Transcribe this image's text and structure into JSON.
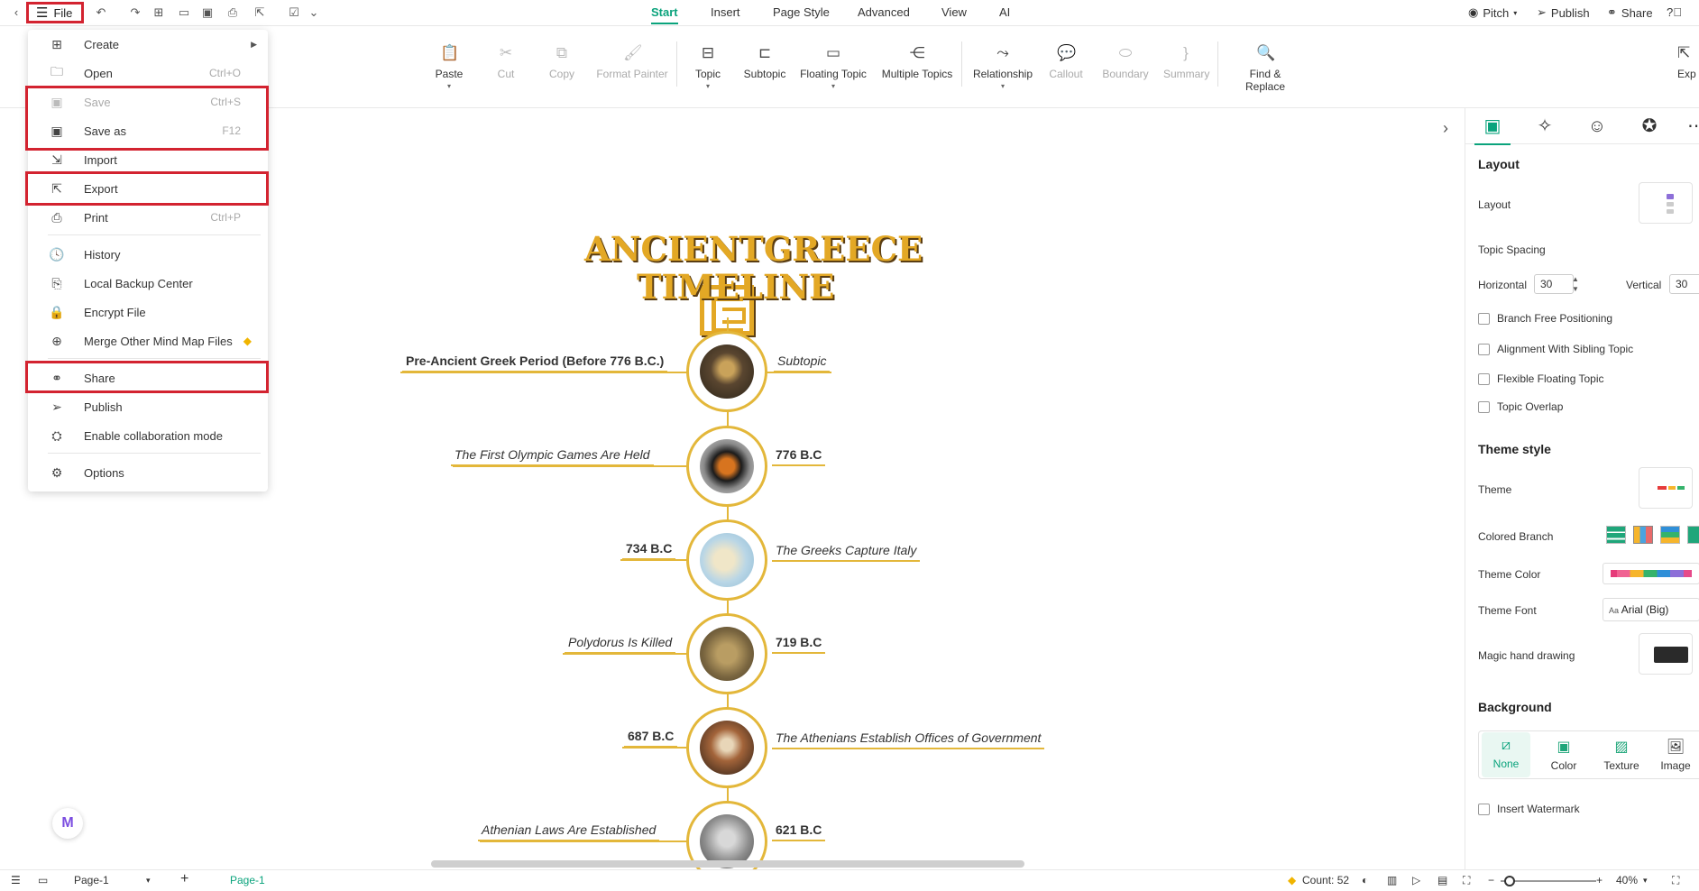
{
  "topbar": {
    "file_label": "File",
    "tabs": [
      "Start",
      "Insert",
      "Page Style",
      "Advanced",
      "View",
      "AI"
    ],
    "active_tab": "Start",
    "right_tools": {
      "pitch": "Pitch",
      "publish": "Publish",
      "share": "Share"
    }
  },
  "ribbon": {
    "paste": "Paste",
    "cut": "Cut",
    "copy": "Copy",
    "format_painter": "Format Painter",
    "topic": "Topic",
    "subtopic": "Subtopic",
    "floating_topic": "Floating Topic",
    "multiple_topics": "Multiple Topics",
    "relationship": "Relationship",
    "callout": "Callout",
    "boundary": "Boundary",
    "summary": "Summary",
    "find_replace": "Find & Replace",
    "export_cut": "Exp"
  },
  "file_menu": {
    "items": [
      {
        "label": "Create",
        "shortcut": ""
      },
      {
        "label": "Open",
        "shortcut": "Ctrl+O"
      },
      {
        "label": "Save",
        "shortcut": "Ctrl+S"
      },
      {
        "label": "Save as",
        "shortcut": "F12"
      },
      {
        "label": "Import",
        "shortcut": ""
      },
      {
        "label": "Export",
        "shortcut": ""
      },
      {
        "label": "Print",
        "shortcut": "Ctrl+P"
      },
      {
        "label": "History",
        "shortcut": ""
      },
      {
        "label": "Local Backup Center",
        "shortcut": ""
      },
      {
        "label": "Encrypt File",
        "shortcut": ""
      },
      {
        "label": "Merge Other Mind Map Files",
        "shortcut": ""
      },
      {
        "label": "Share",
        "shortcut": ""
      },
      {
        "label": "Publish",
        "shortcut": ""
      },
      {
        "label": "Enable collaboration mode",
        "shortcut": ""
      },
      {
        "label": "Options",
        "shortcut": ""
      }
    ]
  },
  "canvas": {
    "title_line1": "ANCIENTGREECE",
    "title_line2": "TIMELINE",
    "nodes": [
      {
        "left": "Pre-Ancient Greek Period (Before 776 B.C.)",
        "right": "Subtopic"
      },
      {
        "left": "The First Olympic Games Are Held",
        "right": "776 B.C"
      },
      {
        "left": "734 B.C",
        "right": "The Greeks Capture Italy"
      },
      {
        "left": "Polydorus Is Killed",
        "right": "719 B.C"
      },
      {
        "left": "687 B.C",
        "right": "The Athenians Establish Offices of Government"
      },
      {
        "left": "Athenian Laws Are Established",
        "right": "621 B.C"
      }
    ]
  },
  "right_panel": {
    "layout_heading": "Layout",
    "layout_label": "Layout",
    "topic_spacing": "Topic Spacing",
    "horizontal_label": "Horizontal",
    "horizontal_value": "30",
    "vertical_label": "Vertical",
    "vertical_value": "30",
    "checks": [
      "Branch Free Positioning",
      "Alignment With Sibling Topic",
      "Flexible Floating Topic",
      "Topic Overlap"
    ],
    "theme_style_heading": "Theme style",
    "theme_label": "Theme",
    "colored_branch_label": "Colored Branch",
    "theme_color_label": "Theme Color",
    "theme_font_label": "Theme Font",
    "theme_font_value": "Arial (Big)",
    "magic_label": "Magic hand drawing",
    "background_heading": "Background",
    "bg_options": [
      "None",
      "Color",
      "Texture",
      "Image"
    ],
    "insert_watermark": "Insert Watermark"
  },
  "statusbar": {
    "page_select": "Page-1",
    "page_tab": "Page-1",
    "count": "Count: 52",
    "zoom": "40%"
  }
}
